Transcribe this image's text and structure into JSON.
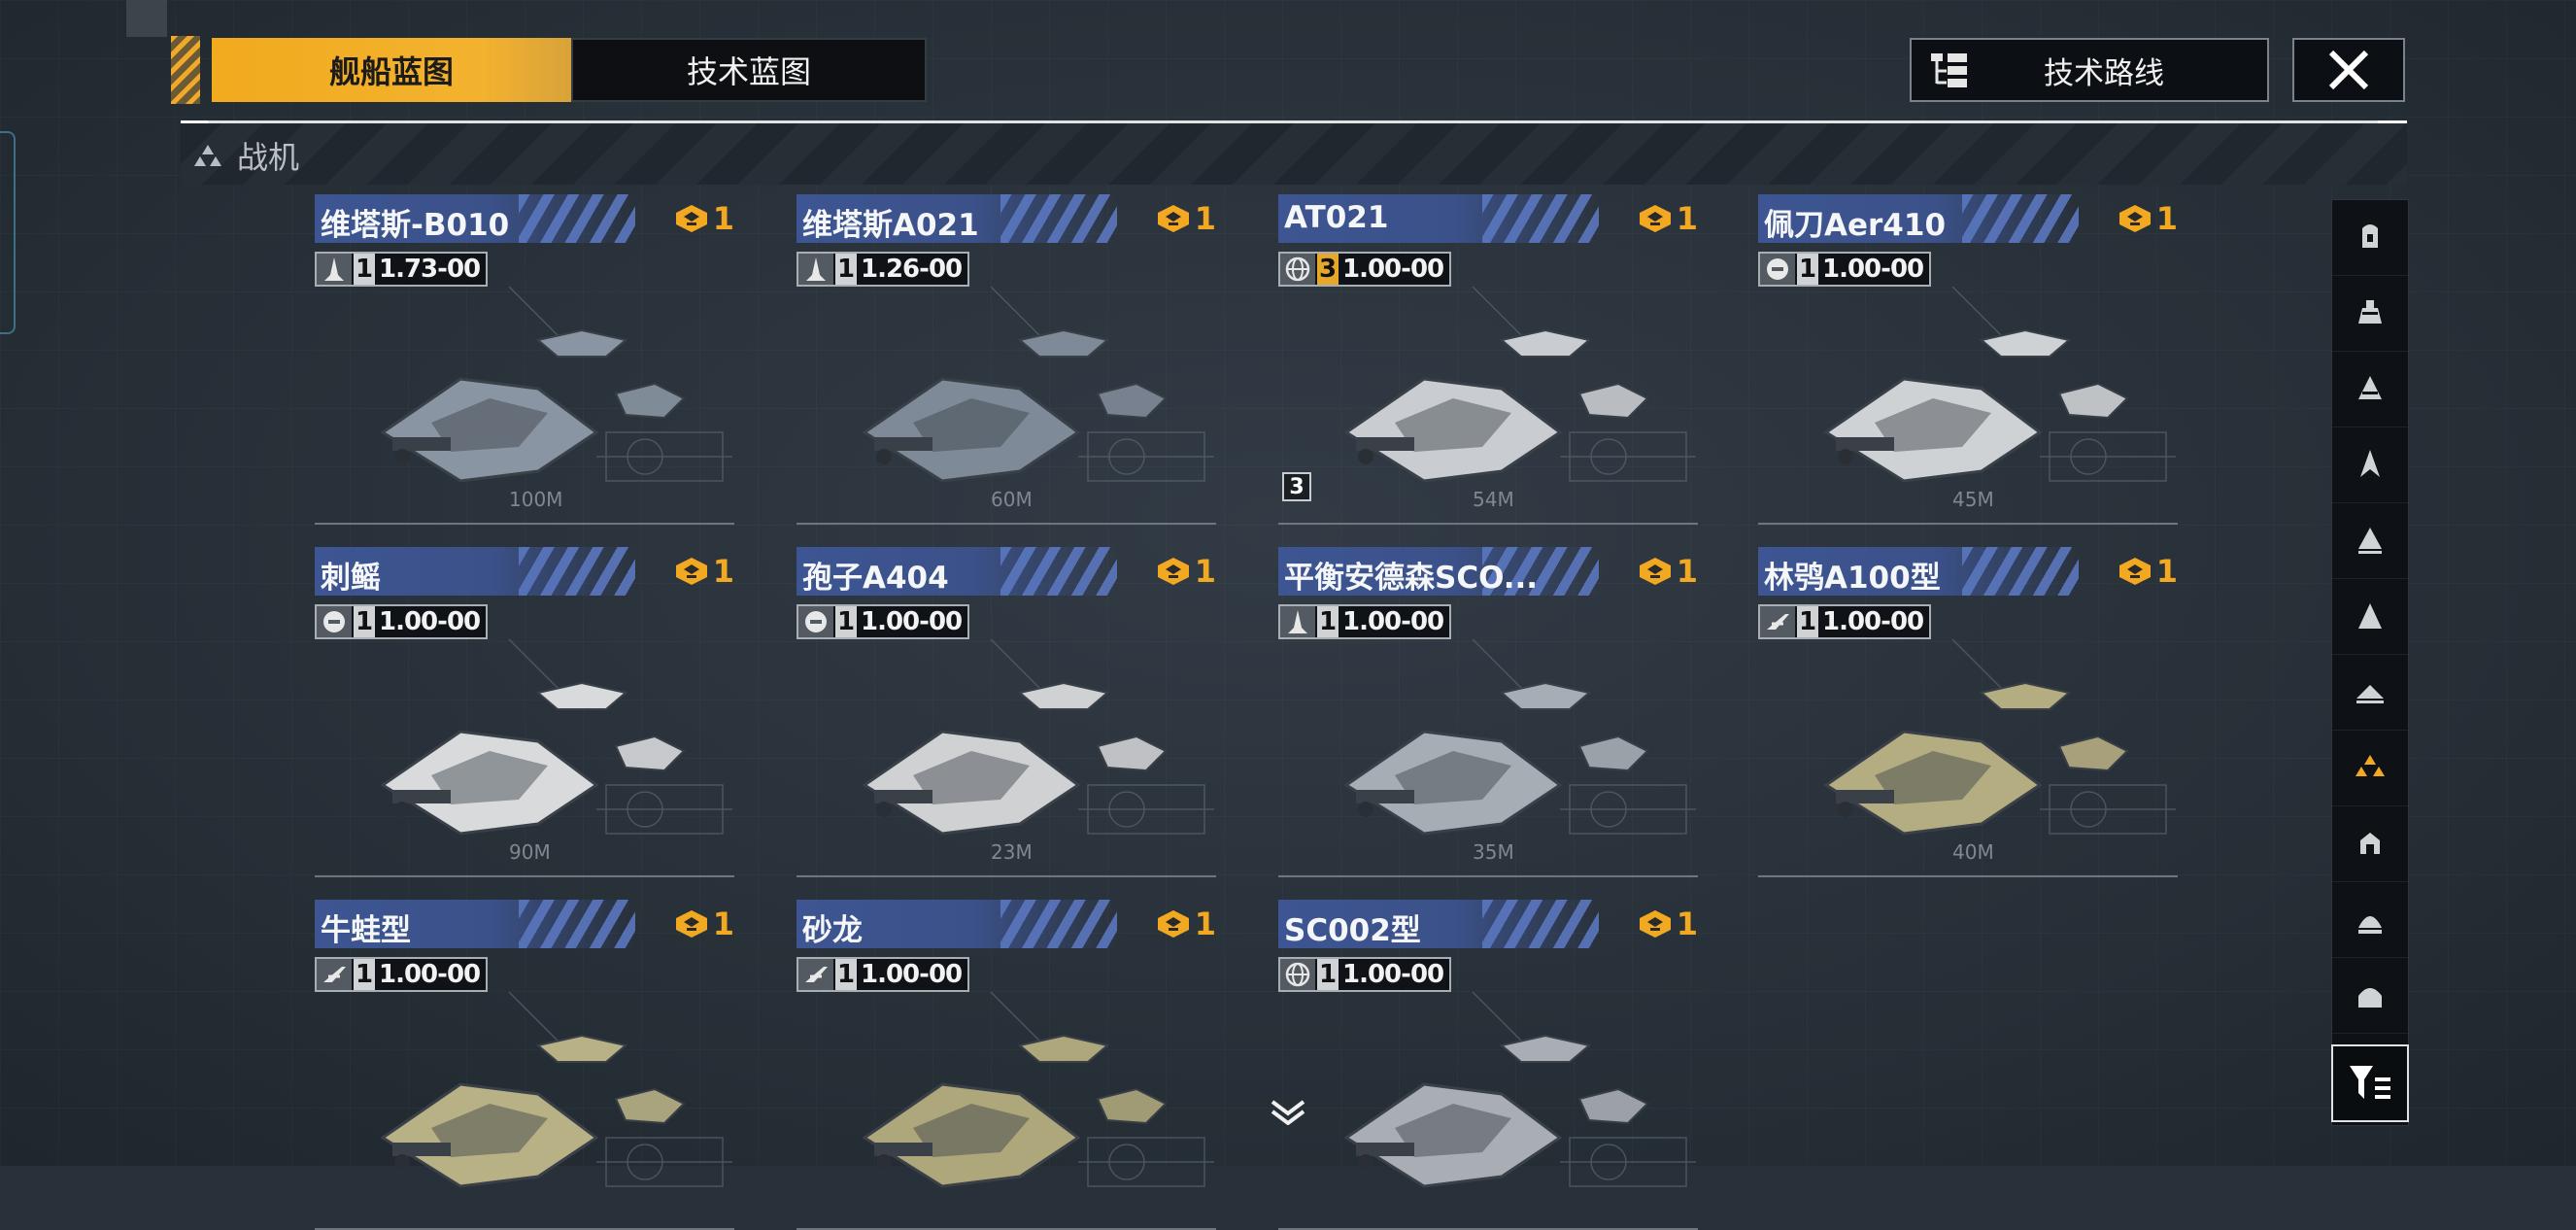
{
  "tabs": [
    {
      "label": "舰船蓝图",
      "active": true
    },
    {
      "label": "技术蓝图",
      "active": false
    }
  ],
  "tech_route_label": "技术路线",
  "section_title": "战机",
  "colors": {
    "accent": "#f2aa1e",
    "name_bar": "#3d5592",
    "rank_gold": "#f2a821"
  },
  "ships": [
    {
      "name": "维塔斯-B010",
      "rank": "1",
      "class_icon": "fighter-icon",
      "level": "1",
      "level_gold": false,
      "stat": "1.73-00",
      "size": "100M",
      "count": ""
    },
    {
      "name": "维塔斯A021",
      "rank": "1",
      "class_icon": "fighter-icon",
      "level": "1",
      "level_gold": false,
      "stat": "1.26-00",
      "size": "60M",
      "count": ""
    },
    {
      "name": "AT021",
      "rank": "1",
      "class_icon": "globe-icon",
      "level": "3",
      "level_gold": true,
      "stat": "1.00-00",
      "size": "54M",
      "count": "3"
    },
    {
      "name": "佩刀Aer410",
      "rank": "1",
      "class_icon": "faction-icon",
      "level": "1",
      "level_gold": false,
      "stat": "1.00-00",
      "size": "45M",
      "count": ""
    },
    {
      "name": "刺鳐",
      "rank": "1",
      "class_icon": "faction-icon",
      "level": "1",
      "level_gold": false,
      "stat": "1.00-00",
      "size": "90M",
      "count": ""
    },
    {
      "name": "孢子A404",
      "rank": "1",
      "class_icon": "faction-icon",
      "level": "1",
      "level_gold": false,
      "stat": "1.00-00",
      "size": "23M",
      "count": ""
    },
    {
      "name": "平衡安德森SCO...",
      "rank": "1",
      "class_icon": "fighter-icon",
      "level": "1",
      "level_gold": false,
      "stat": "1.00-00",
      "size": "35M",
      "count": ""
    },
    {
      "name": "林鸮A100型",
      "rank": "1",
      "class_icon": "wing-icon",
      "level": "1",
      "level_gold": false,
      "stat": "1.00-00",
      "size": "40M",
      "count": ""
    },
    {
      "name": "牛蛙型",
      "rank": "1",
      "class_icon": "wing-icon",
      "level": "1",
      "level_gold": false,
      "stat": "1.00-00",
      "size": "",
      "count": ""
    },
    {
      "name": "砂龙",
      "rank": "1",
      "class_icon": "wing-icon",
      "level": "1",
      "level_gold": false,
      "stat": "1.00-00",
      "size": "",
      "count": ""
    },
    {
      "name": "SC002型",
      "rank": "1",
      "class_icon": "globe-icon",
      "level": "1",
      "level_gold": false,
      "stat": "1.00-00",
      "size": "",
      "count": ""
    }
  ],
  "filters": [
    "carrier-icon",
    "battlecruiser-icon",
    "cruiser-icon",
    "destroyer-icon",
    "frigate-icon",
    "fighter-class-icon",
    "corvette-icon",
    "squadron-icon",
    "utility-icon",
    "station-icon",
    "defense-icon"
  ],
  "active_filter_index": 7
}
